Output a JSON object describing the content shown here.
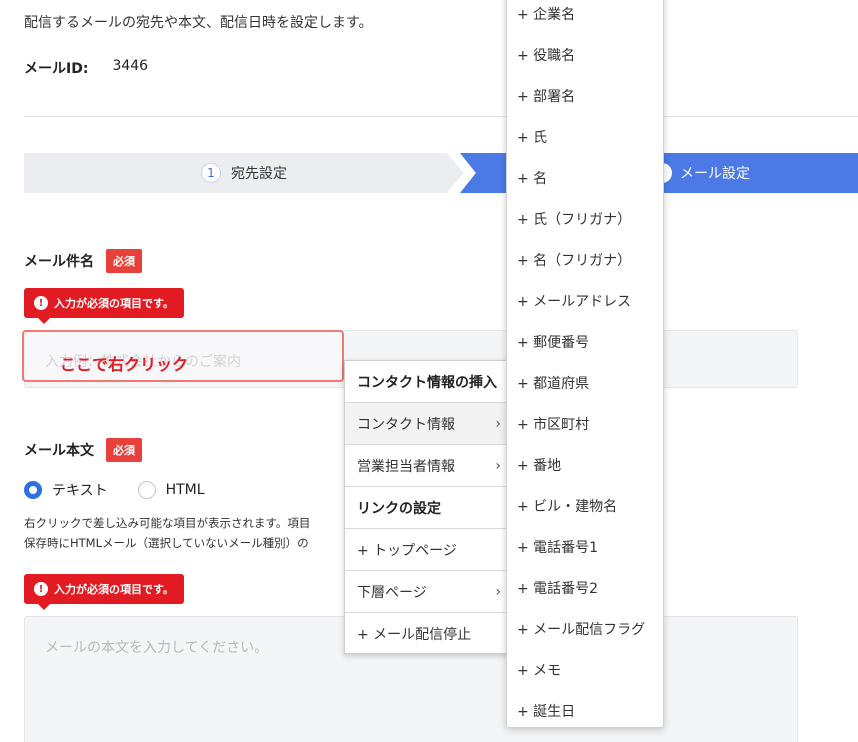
{
  "intro": "配信するメールの宛先や本文、配信日時を設定します。",
  "mail_id": {
    "label": "メールID:",
    "value": "3446"
  },
  "stepper": {
    "step1": {
      "num": "1",
      "label": "宛先設定"
    },
    "step2": {
      "label": "メール設定"
    }
  },
  "subject": {
    "label": "メール件名",
    "required": "必須",
    "error": "入力が必須の項目です。",
    "placeholder": "入力例：株式会社からのご案内",
    "annotation": "ここで右クリック"
  },
  "body": {
    "label": "メール本文",
    "required": "必須",
    "radio_text": "テキスト",
    "radio_html": "HTML",
    "help_line1": "右クリックで差し込み可能な項目が表示されます。項目",
    "help_line2": "保存時にHTMLメール（選択していないメール種別）の",
    "error": "入力が必須の項目です。",
    "placeholder": "メールの本文を入力してください。"
  },
  "context_menu": {
    "items": [
      {
        "label": "コンタクト情報の挿入",
        "header": true
      },
      {
        "label": "コンタクト情報",
        "arrow": "›"
      },
      {
        "label": "営業担当者情報",
        "arrow": "›"
      },
      {
        "label": "リンクの設定",
        "header": true
      },
      {
        "label": "+ トップページ"
      },
      {
        "label": "下層ページ",
        "arrow": "›"
      },
      {
        "label": "+ メール配信停止"
      }
    ]
  },
  "submenu": {
    "items": [
      "+ 企業名",
      "+ 役職名",
      "+ 部署名",
      "+ 氏",
      "+ 名",
      "+ 氏（フリガナ）",
      "+ 名（フリガナ）",
      "+ メールアドレス",
      "+ 郵便番号",
      "+ 都道府県",
      "+ 市区町村",
      "+ 番地",
      "+ ビル・建物名",
      "+ 電話番号1",
      "+ 電話番号2",
      "+ メール配信フラグ",
      "+ メモ",
      "+ 誕生日"
    ]
  },
  "colors": {
    "accent": "#4b7ae6",
    "error": "#e21a22",
    "required": "#e8403a"
  }
}
